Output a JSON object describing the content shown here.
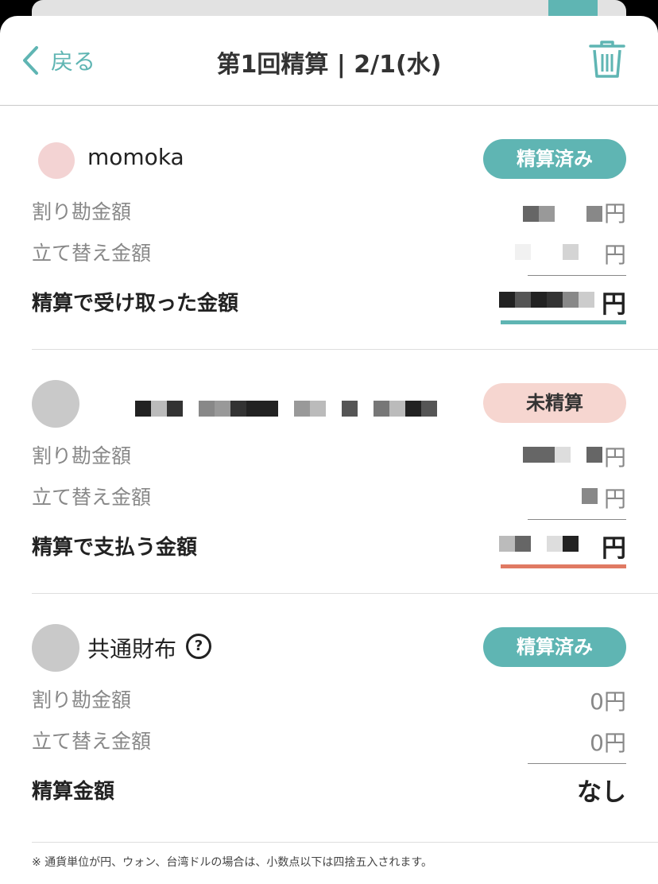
{
  "header": {
    "back_label": "戻る",
    "title": "第1回精算 | 2/1(水)"
  },
  "members": [
    {
      "name": "momoka",
      "status": "精算済み",
      "split_label": "割り勘金額",
      "split_amount": "円",
      "advance_label": "立て替え金額",
      "advance_amount": "円",
      "total_label": "精算で受け取った金額",
      "total_amount": "円"
    },
    {
      "name": "",
      "status": "未精算",
      "split_label": "割り勘金額",
      "split_amount": "円",
      "advance_label": "立て替え金額",
      "advance_amount": "円",
      "total_label": "精算で支払う金額",
      "total_amount": "円"
    },
    {
      "name": "共通財布",
      "status": "精算済み",
      "help_icon": "?",
      "split_label": "割り勘金額",
      "split_amount": "0円",
      "advance_label": "立て替え金額",
      "advance_amount": "0円",
      "total_label": "精算金額",
      "total_amount": "なし"
    }
  ],
  "footnote": "※ 通貨単位が円、ウォン、台湾ドルの場合は、小数点以下は四捨五入されます。",
  "colors": {
    "accent": "#5fb5b3",
    "settled_badge": "#5fb5b3",
    "unsettled_badge": "#f6d6d0",
    "pay_underline": "#e07a63"
  }
}
